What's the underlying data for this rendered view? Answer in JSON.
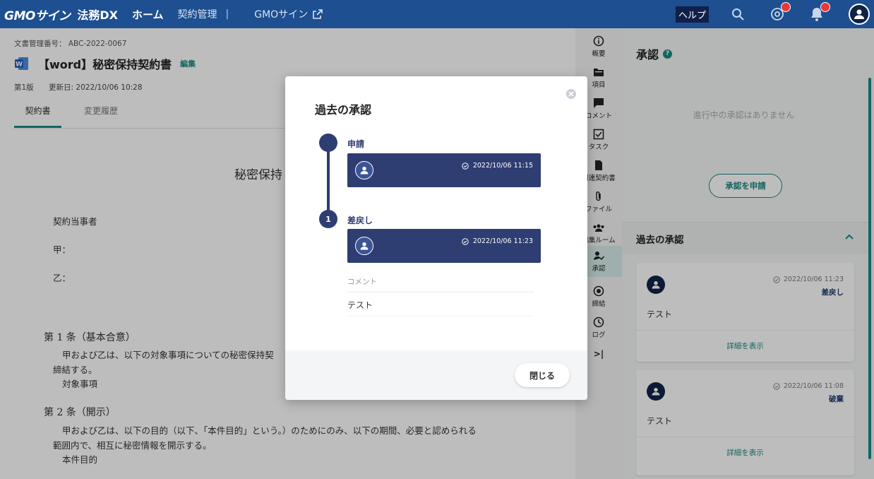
{
  "header": {
    "logo_brand": "GMOサイン",
    "logo_product": "法務DX",
    "nav_home": "ホーム",
    "nav_contract": "契約管理",
    "nav_separator": "|",
    "nav_gmo_sign": "GMOサイン",
    "help": "ヘルプ"
  },
  "document": {
    "doc_number": "文書管理番号： ABC-2022-0067",
    "title": "【word】秘密保持契約書",
    "edit": "編集",
    "version": "第1版",
    "updated": "更新日: 2022/10/06 10:28",
    "tabs": [
      "契約書",
      "変更履歴"
    ]
  },
  "paper": {
    "title": "秘密保持",
    "lines": [
      "契約当事者",
      "甲：",
      "乙：",
      "第 1 条（基本合意）",
      "甲および乙は、以下の対象事項についての秘密保持契",
      "締結する。",
      "対象事項",
      "第 2 条（開示）",
      "甲および乙は、以下の目的（以下、「本件目的」という。）のためにのみ、以下の期間、必要と認められる",
      "範囲内で、相互に秘密情報を開示する。",
      "本件目的"
    ]
  },
  "rail": {
    "items": [
      {
        "label": "概要",
        "icon": "info-icon"
      },
      {
        "label": "項目",
        "icon": "folder-icon"
      },
      {
        "label": "コメント",
        "icon": "comment-icon"
      },
      {
        "label": "タスク",
        "icon": "checkbox-icon"
      },
      {
        "label": "関連契約書",
        "icon": "file-icon"
      },
      {
        "label": "ファイル",
        "icon": "paperclip-icon"
      },
      {
        "label": "編集ルーム",
        "icon": "group-icon"
      },
      {
        "label": "承認",
        "icon": "person-check-icon"
      },
      {
        "label": "締結",
        "icon": "target-icon"
      },
      {
        "label": "ログ",
        "icon": "clock-icon"
      }
    ],
    "collapse": ">|"
  },
  "right_panel": {
    "title": "承認",
    "empty_text": "進行中の承認はありません",
    "apply_button": "承認を申請",
    "past_header": "過去の承認",
    "cards": [
      {
        "datetime": "2022/10/06 11:23",
        "status": "差戻し",
        "comment": "テスト",
        "more": "詳細を表示"
      },
      {
        "datetime": "2022/10/06 11:08",
        "status": "破棄",
        "comment": "テスト",
        "more": "詳細を表示"
      }
    ]
  },
  "modal": {
    "title": "過去の承認",
    "steps": [
      {
        "marker": "",
        "label": "申請",
        "datetime": "2022/10/06 11:15"
      },
      {
        "marker": "1",
        "label": "差戻し",
        "datetime": "2022/10/06 11:23"
      }
    ],
    "comment_label": "コメント",
    "comment_value": "テスト",
    "close_button": "閉じる"
  },
  "colors": {
    "header": "#1d4f91",
    "accent": "#1a8a83",
    "timeline": "#2e3d72"
  }
}
